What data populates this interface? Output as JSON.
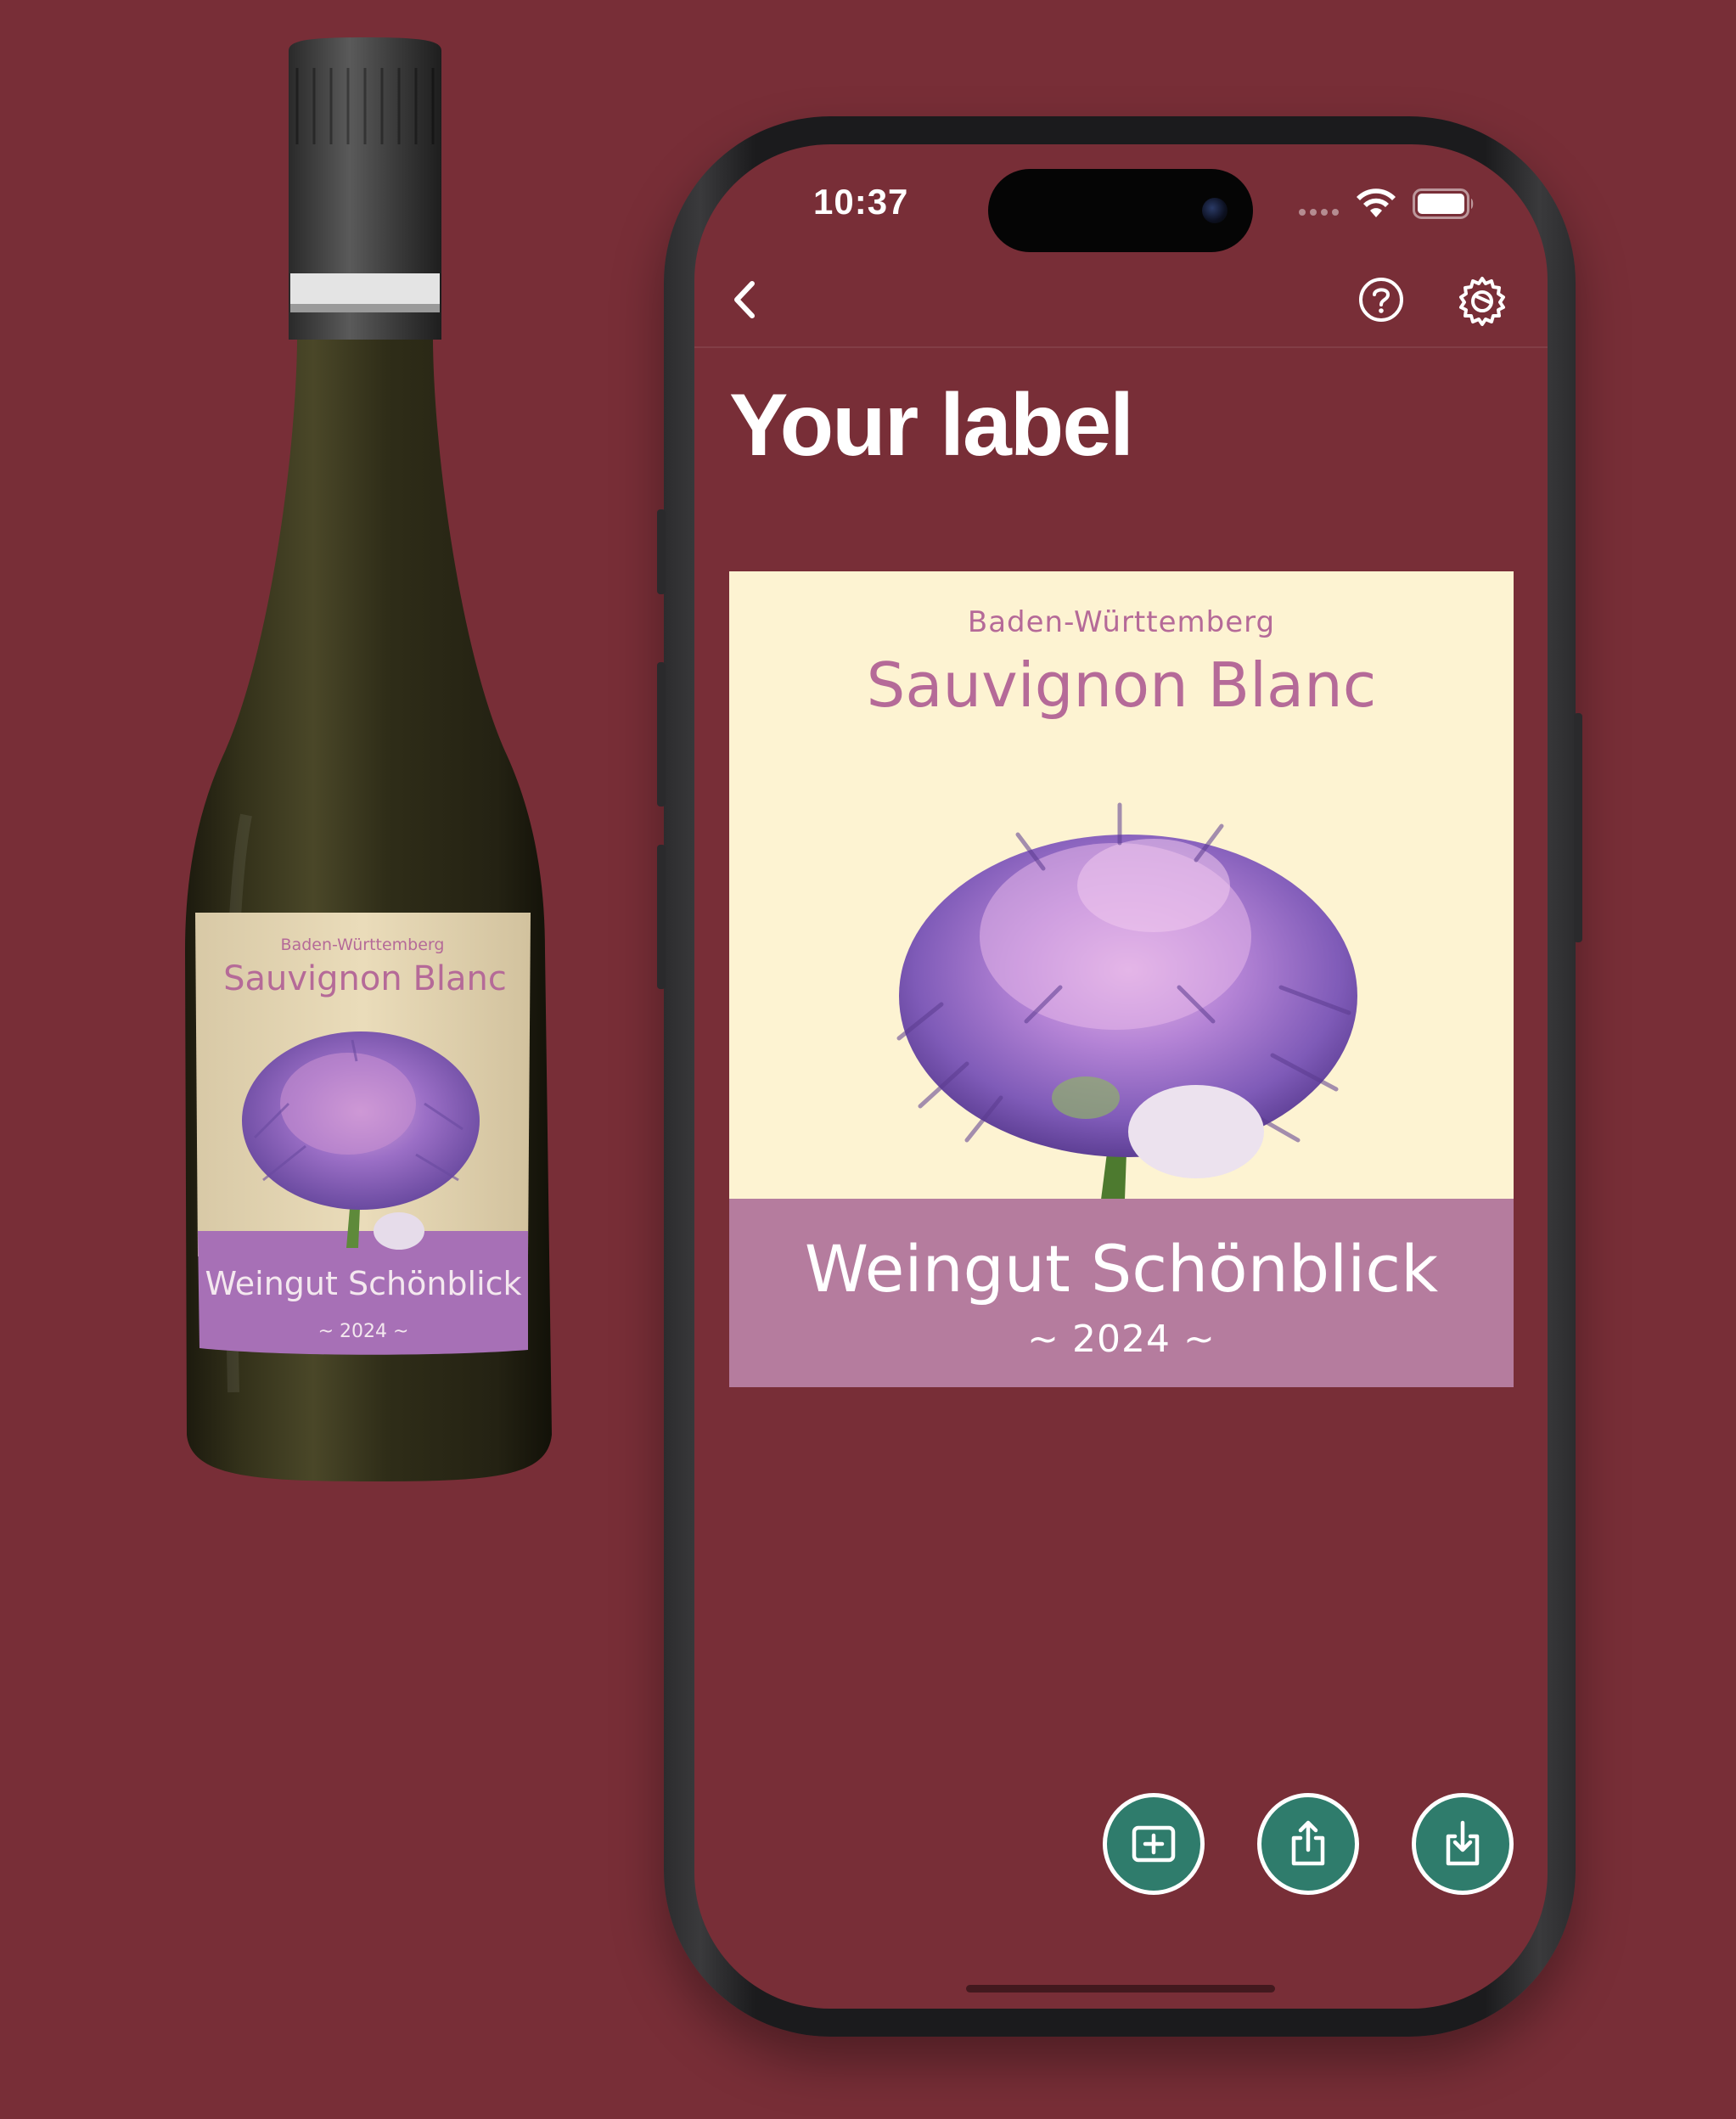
{
  "colors": {
    "background": "#782e37",
    "label_cream": "#fdf3d2",
    "label_purple": "#b56a98",
    "label_band": "#b57c9e",
    "fab_green": "#2f7c6c"
  },
  "bottle_label": {
    "region": "Baden-Württemberg",
    "grape": "Sauvignon Blanc",
    "winery": "Weingut Schönblick",
    "year": "~ 2024 ~"
  },
  "status_bar": {
    "time": "10:37",
    "icons": [
      "signal-icon",
      "wifi-icon",
      "battery-icon"
    ]
  },
  "nav": {
    "icons": [
      "back-chevron-icon",
      "help-icon",
      "settings-gear-icon"
    ]
  },
  "page": {
    "title": "Your label"
  },
  "label": {
    "region": "Baden-Württemberg",
    "grape": "Sauvignon Blanc",
    "winery": "Weingut Schönblick",
    "year": "~ 2024 ~",
    "image": "allium-flower"
  },
  "actions": {
    "icons": [
      "add-icon",
      "share-icon",
      "download-icon"
    ]
  }
}
